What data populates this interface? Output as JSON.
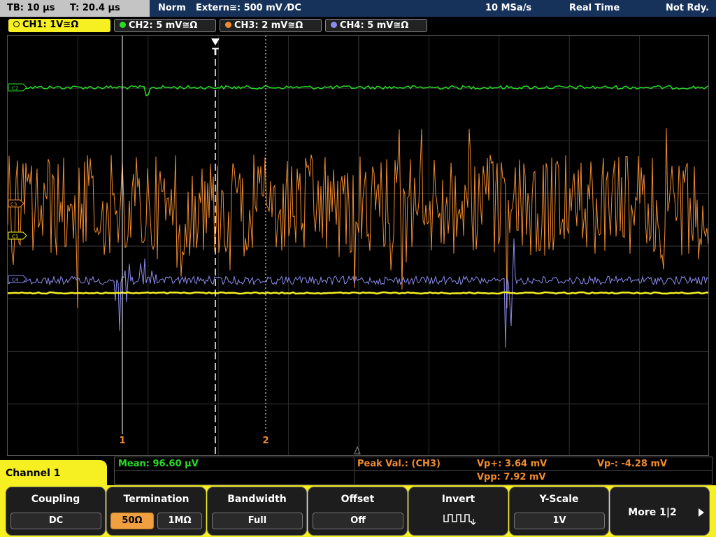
{
  "topbar": {
    "timebase": "TB: 10 µs",
    "trigger_time": "T: 20.4 µs",
    "mode": "Norm",
    "trigger": "Extern≅: 500 mV ⁄DC",
    "sample_rate": "10 MSa/s",
    "acquisition": "Real Time",
    "status": "Not Rdy."
  },
  "channels": [
    {
      "label": "CH1: 1V≅Ω",
      "color": "#f6ef21"
    },
    {
      "label": "CH2: 5 mV≅Ω",
      "color": "#28dc28"
    },
    {
      "label": "CH3: 2 mV≅Ω",
      "color": "#f08c30"
    },
    {
      "label": "CH4: 5 mV≅Ω",
      "color": "#8c8cf0"
    }
  ],
  "grid": {
    "trigger_marker": "T",
    "cursor_1": "1",
    "cursor_2": "2",
    "ch_markers": [
      "C2",
      "C3",
      "C1",
      "C4"
    ]
  },
  "measurements": {
    "mean": "Mean: 96.60 µV",
    "peak_label": "Peak Val.:  (CH3)",
    "vp_plus": "Vp+: 3.64 mV",
    "vp_minus": "Vp-: -4.28 mV",
    "vpp": "Vpp: 7.92 mV"
  },
  "menu": {
    "title": "Channel 1",
    "coupling": {
      "label": "Coupling",
      "value": "DC"
    },
    "termination": {
      "label": "Termination",
      "opt1": "50Ω",
      "opt2": "1MΩ"
    },
    "bandwidth": {
      "label": "Bandwidth",
      "value": "Full"
    },
    "offset": {
      "label": "Offset",
      "value": "Off"
    },
    "invert": {
      "label": "Invert"
    },
    "yscale": {
      "label": "Y-Scale",
      "value": "1V"
    },
    "more": {
      "label": "More 1|2"
    }
  },
  "colors": {
    "ch1": "#f6ef21",
    "ch2": "#28dc28",
    "ch3": "#f08c30",
    "ch4": "#8c8cf0",
    "header_bg": "#16325a"
  }
}
